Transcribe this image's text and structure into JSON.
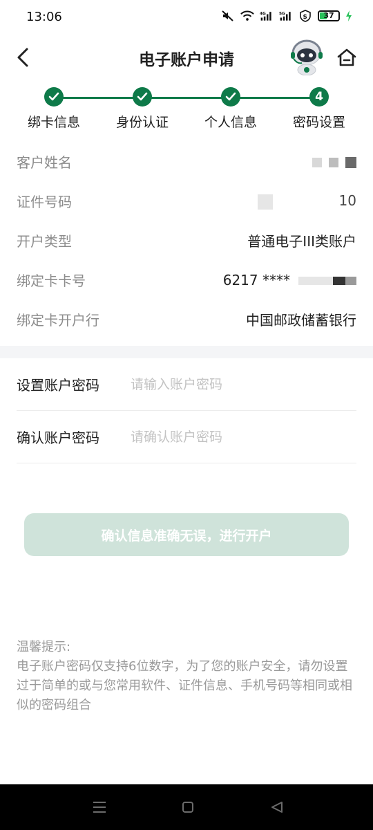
{
  "status_bar": {
    "time": "13:06",
    "battery": "37",
    "icons": [
      "mute-icon",
      "wifi-icon",
      "4g-signal-icon",
      "5g-signal-icon",
      "shield-icon",
      "battery-icon",
      "charging-icon"
    ]
  },
  "header": {
    "title": "电子账户申请",
    "back_icon": "back-arrow-icon",
    "avatar_icon": "robot-assistant-icon",
    "home_icon": "home-icon"
  },
  "stepper": {
    "steps": [
      {
        "label": "绑卡信息",
        "state": "done"
      },
      {
        "label": "身份认证",
        "state": "done"
      },
      {
        "label": "个人信息",
        "state": "done"
      },
      {
        "label": "密码设置",
        "state": "current",
        "number": "4"
      }
    ]
  },
  "info": {
    "rows": [
      {
        "label": "客户姓名",
        "value": ""
      },
      {
        "label": "证件号码",
        "value": "               10"
      },
      {
        "label": "开户类型",
        "value": "普通电子III类账户"
      },
      {
        "label": "绑定卡卡号",
        "value": "6217 ****"
      },
      {
        "label": "绑定卡开户行",
        "value": "中国邮政储蓄银行"
      }
    ]
  },
  "form": {
    "password": {
      "label": "设置账户密码",
      "placeholder": "请输入账户密码"
    },
    "confirm": {
      "label": "确认账户密码",
      "placeholder": "请确认账户密码"
    }
  },
  "submit_label": "确认信息准确无误，进行开户",
  "tips": {
    "title": "温馨提示:",
    "body": "电子账户密码仅支持6位数字，为了您的账户安全，请勿设置过于简单的或与您常用软件、证件信息、手机号码等相同或相似的密码组合"
  },
  "colors": {
    "accent": "#0e7a49",
    "button_disabled": "#cfe3da",
    "placeholder": "#c3c3c3"
  }
}
